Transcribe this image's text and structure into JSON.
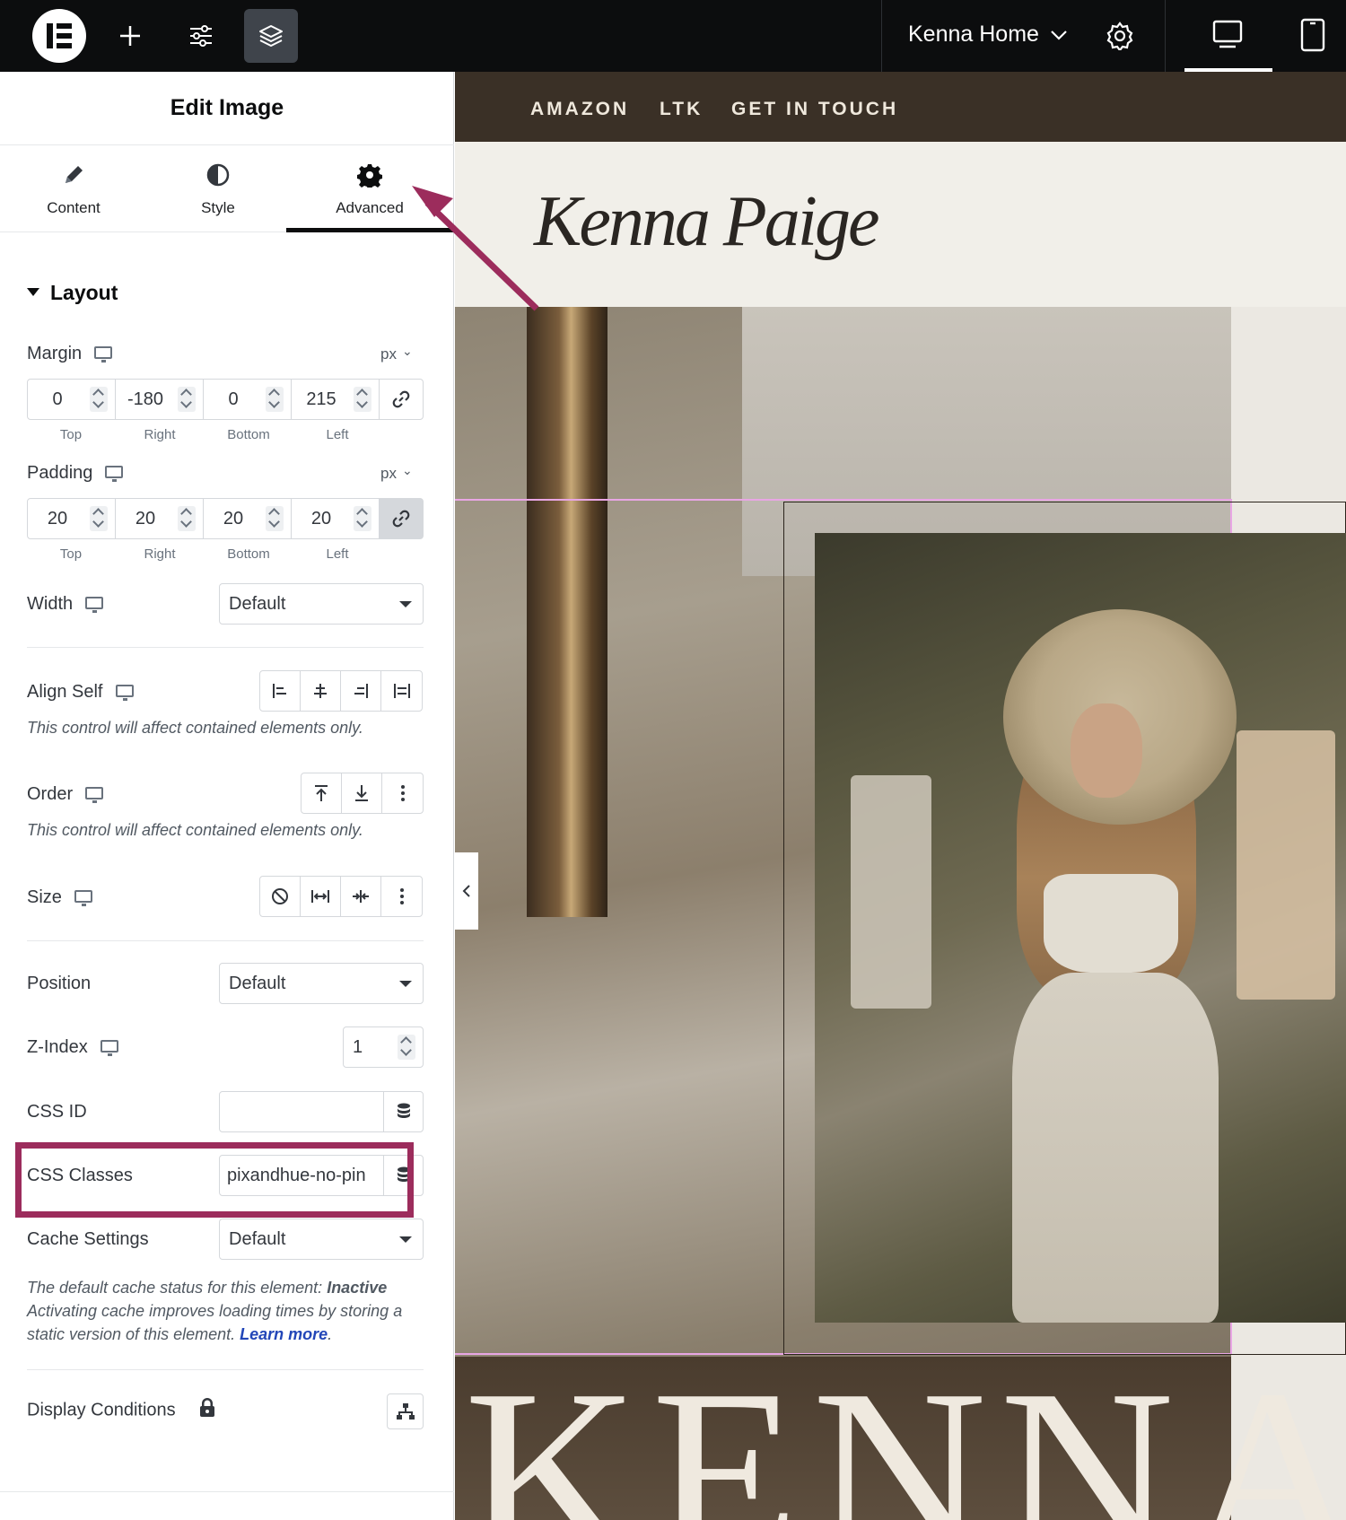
{
  "topbar": {
    "site_name": "Kenna Home"
  },
  "panel": {
    "title": "Edit Image",
    "tabs": [
      {
        "label": "Content",
        "icon": "pencil-icon"
      },
      {
        "label": "Style",
        "icon": "half-circle-icon"
      },
      {
        "label": "Advanced",
        "icon": "gear-icon",
        "active": true
      }
    ],
    "section": "Layout",
    "margin": {
      "label": "Margin",
      "unit": "px",
      "values": [
        "0",
        "-180",
        "0",
        "215"
      ],
      "sides": [
        "Top",
        "Right",
        "Bottom",
        "Left"
      ],
      "linked": false
    },
    "padding": {
      "label": "Padding",
      "unit": "px",
      "values": [
        "20",
        "20",
        "20",
        "20"
      ],
      "sides": [
        "Top",
        "Right",
        "Bottom",
        "Left"
      ],
      "linked": true
    },
    "width": {
      "label": "Width",
      "value": "Default"
    },
    "align_self": {
      "label": "Align Self",
      "note": "This control will affect contained elements only."
    },
    "order": {
      "label": "Order",
      "note": "This control will affect contained elements only."
    },
    "size": {
      "label": "Size"
    },
    "position": {
      "label": "Position",
      "value": "Default"
    },
    "z_index": {
      "label": "Z-Index",
      "value": "1"
    },
    "css_id": {
      "label": "CSS ID",
      "value": ""
    },
    "css_classes": {
      "label": "CSS Classes",
      "value": "pixandhue-no-pin"
    },
    "cache": {
      "label": "Cache Settings",
      "value": "Default",
      "note_prefix": "The default cache status for this element: ",
      "note_status": "Inactive",
      "note_body": "Activating cache improves loading times by storing a static version of this element. ",
      "learn_more": "Learn more",
      "note_suffix": "."
    },
    "display_conditions": {
      "label": "Display Conditions"
    }
  },
  "preview": {
    "nav": [
      "AMAZON",
      "LTK",
      "GET IN TOUCH"
    ],
    "brand": "Kenna Paige",
    "big_word": "KENNA"
  },
  "colors": {
    "annotation": "#9c2c5c",
    "topbar": "#0c0d0e",
    "nav_bg": "#3a3026",
    "link": "#2246b8"
  }
}
